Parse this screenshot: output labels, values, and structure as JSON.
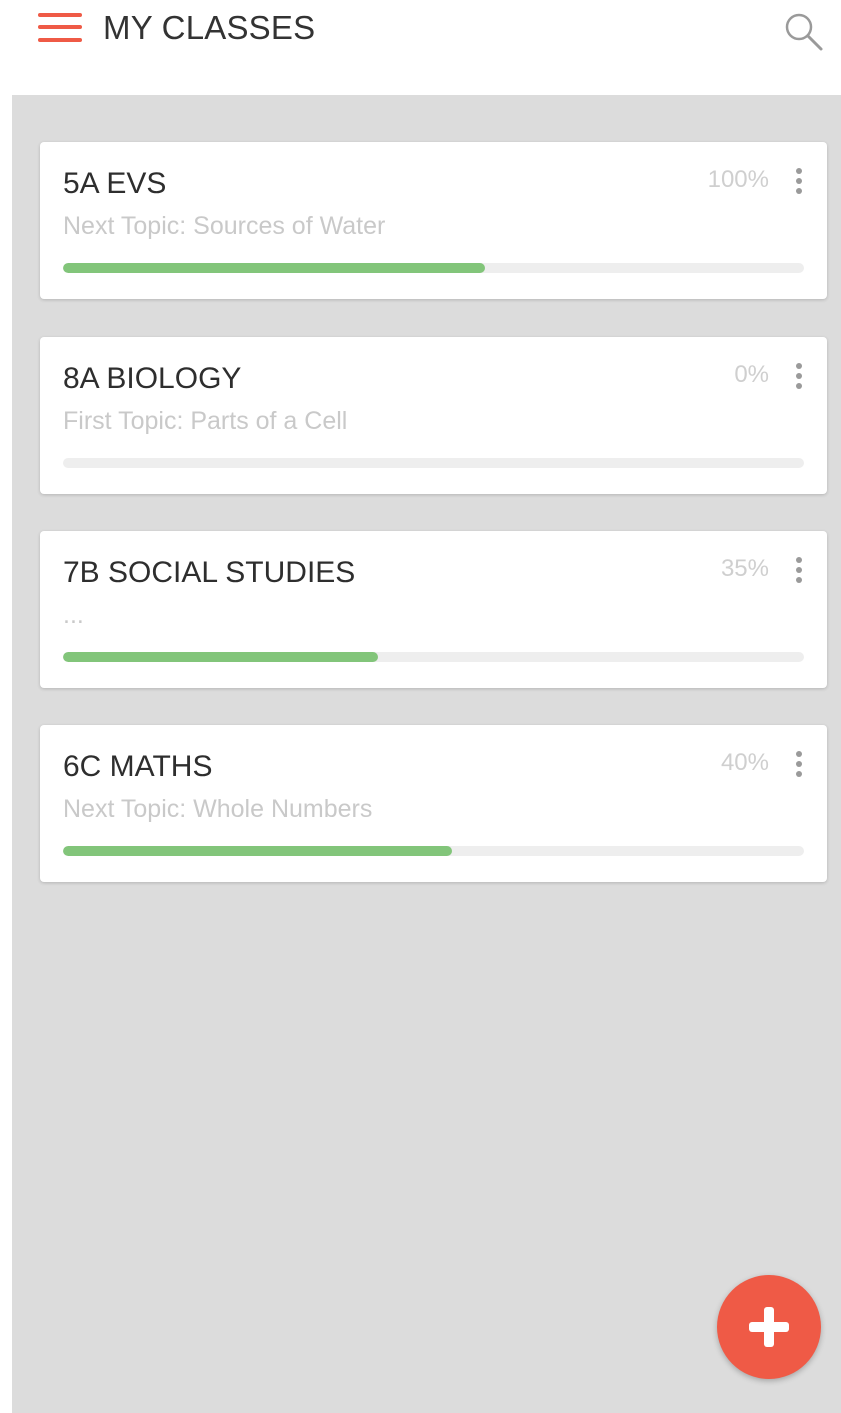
{
  "colors": {
    "accent": "#ef5a46",
    "progress": "#82c57a",
    "background": "#dcdcdc"
  },
  "header": {
    "title": "MY CLASSES",
    "menu_icon": "hamburger-menu-icon",
    "search_icon": "search-icon"
  },
  "classes": [
    {
      "title": "5A EVS",
      "subtitle": "Next Topic: Sources of Water",
      "percent": "100%",
      "progress": 0.57
    },
    {
      "title": "8A BIOLOGY",
      "subtitle": "First Topic: Parts of a Cell",
      "percent": "0%",
      "progress": 0
    },
    {
      "title": "7B SOCIAL STUDIES",
      "subtitle": "...",
      "percent": "35%",
      "progress": 0.425
    },
    {
      "title": "6C MATHS",
      "subtitle": "Next Topic: Whole Numbers",
      "percent": "40%",
      "progress": 0.525
    }
  ],
  "fab": {
    "icon": "plus-icon"
  }
}
